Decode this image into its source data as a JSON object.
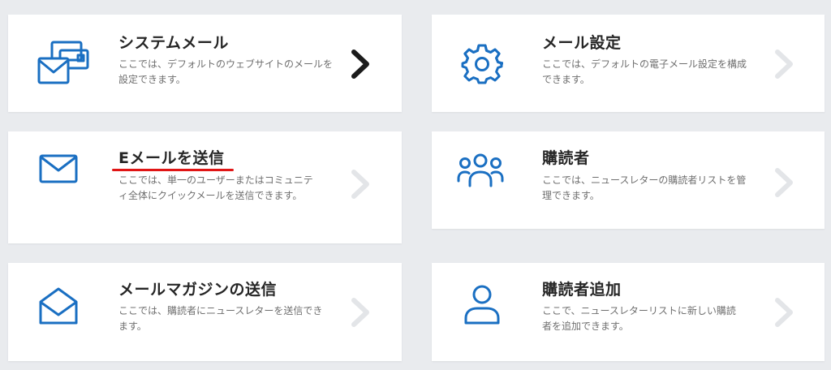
{
  "colors": {
    "background": "#e9ebee",
    "card": "#ffffff",
    "icon_blue": "#1a6fc2",
    "chevron_active": "#1b1b1b",
    "chevron_inactive": "#e3e5e8",
    "annotation_red": "#e01515"
  },
  "cards": [
    {
      "title": "システムメール",
      "description": "ここでは、デフォルトのウェブサイトのメールを設定できます。",
      "icon": "envelopes-icon",
      "chevron_state": "active"
    },
    {
      "title": "メール設定",
      "description": "ここでは、デフォルトの電子メール設定を構成できます。",
      "icon": "gear-icon",
      "chevron_state": "inactive"
    },
    {
      "title": "Eメールを送信",
      "description": "ここでは、単一のユーザーまたはコミュニティ全体にクイックメールを送信できます。",
      "icon": "envelope-icon",
      "chevron_state": "inactive",
      "annotation": "red-underline"
    },
    {
      "title": "購読者",
      "description": "ここでは、ニュースレターの購読者リストを管理できます。",
      "icon": "users-group-icon",
      "chevron_state": "inactive"
    },
    {
      "title": "メールマガジンの送信",
      "description": "ここでは、購読者にニュースレターを送信できます。",
      "icon": "open-envelope-icon",
      "chevron_state": "inactive"
    },
    {
      "title": "購読者追加",
      "description": "ここで、ニュースレターリストに新しい購読者を追加できます。",
      "icon": "user-add-icon",
      "chevron_state": "inactive"
    }
  ]
}
